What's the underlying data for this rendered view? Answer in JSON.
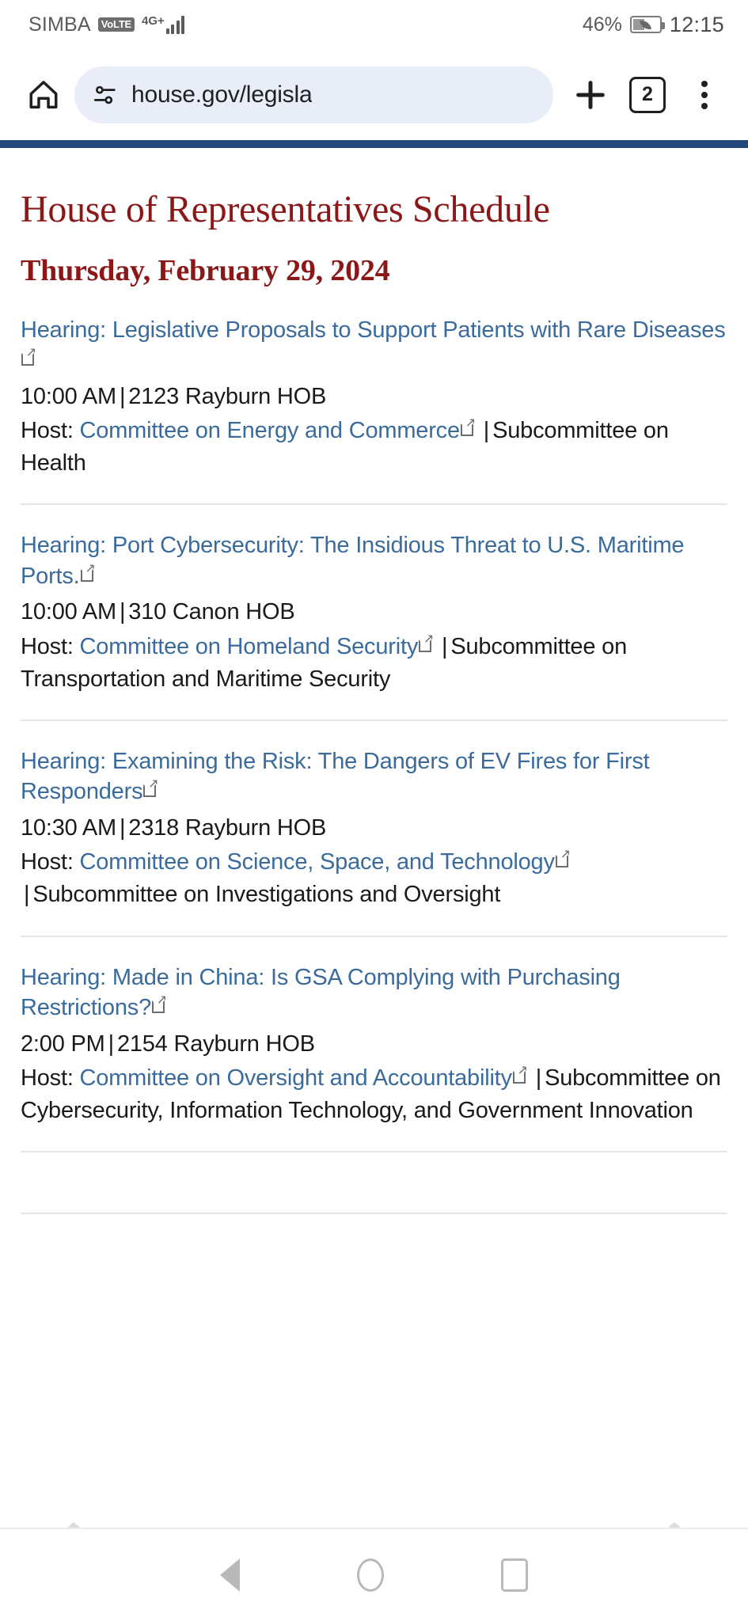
{
  "status_bar": {
    "carrier": "SIMBA",
    "volte": "VoLTE",
    "network": "4G+",
    "battery_percent": "46%",
    "time": "12:15"
  },
  "browser": {
    "home_icon": "home-icon",
    "site_settings_icon": "tune-icon",
    "url": "house.gov/legisla",
    "new_tab_icon": "plus-icon",
    "tab_count": "2",
    "menu_icon": "kebab-menu-icon"
  },
  "page": {
    "title": "House of Representatives Schedule",
    "date": "Thursday, February 29, 2024",
    "host_label": "Host:",
    "separator": "|",
    "events": [
      {
        "title": "Hearing: Legislative Proposals to Support Patients with Rare Diseases",
        "time": "10:00 AM",
        "location": "2123 Rayburn HOB",
        "committee": "Committee on Energy and Commerce",
        "subcommittee": "Subcommittee on Health"
      },
      {
        "title": "Hearing: Port Cybersecurity: The Insidious Threat to U.S. Maritime Ports.",
        "time": "10:00 AM",
        "location": "310 Canon HOB",
        "committee": "Committee on Homeland Security",
        "subcommittee": "Subcommittee on Transportation and Maritime Security"
      },
      {
        "title": "Hearing: Examining the Risk: The Dangers of EV Fires for First Responders",
        "time": "10:30 AM",
        "location": "2318 Rayburn HOB",
        "committee": "Committee on Science, Space, and Technology",
        "subcommittee": "Subcommittee on Investigations and Oversight"
      },
      {
        "title": "Hearing: Made in China: Is GSA Complying with Purchasing Restrictions?",
        "time": "2:00 PM",
        "location": "2154 Rayburn HOB",
        "committee": "Committee on Oversight and Accountability",
        "subcommittee": "Subcommittee on Cybersecurity, Information Technology, and Government Innovation"
      }
    ]
  },
  "android_nav": {
    "back_icon": "back-triangle-icon",
    "home_icon": "home-circle-icon",
    "recents_icon": "recents-square-icon"
  },
  "colors": {
    "heading_red": "#8b1818",
    "link_blue": "#3a6b9c",
    "navy_rule": "#24487a",
    "omnibox_bg": "#e8edf7"
  }
}
